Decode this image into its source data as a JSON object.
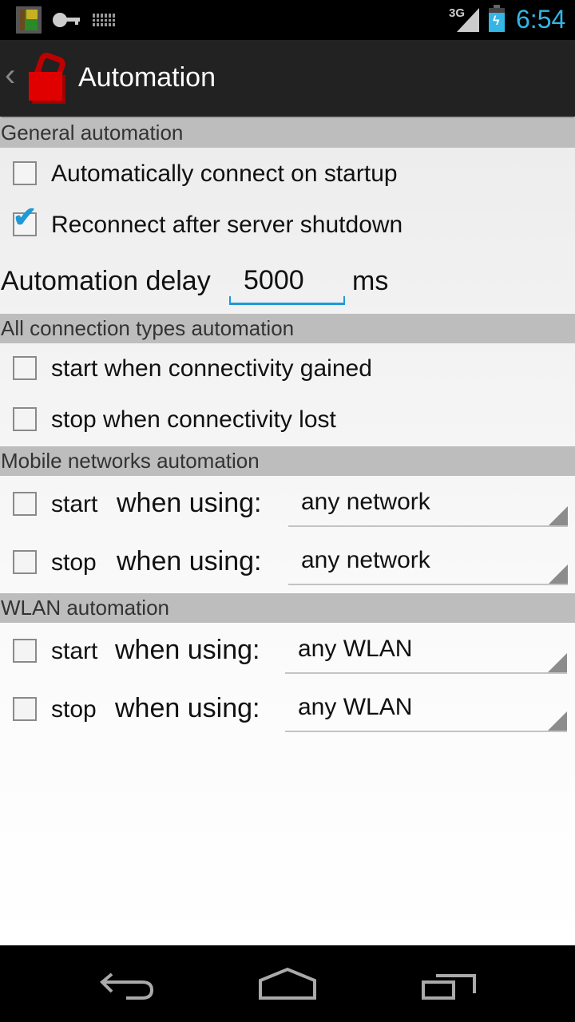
{
  "status_bar": {
    "icons_left": [
      "app-door-icon",
      "key-icon",
      "keyboard-icon"
    ],
    "network": "3G",
    "time": "6:54"
  },
  "action_bar": {
    "back_glyph": "‹",
    "title": "Automation"
  },
  "sections": {
    "general": {
      "title": "General automation",
      "items": [
        {
          "label": "Automatically connect on startup",
          "checked": false
        },
        {
          "label": "Reconnect after server shutdown",
          "checked": true
        }
      ],
      "delay": {
        "label": "Automation delay",
        "value": "5000",
        "unit": "ms"
      }
    },
    "all_connections": {
      "title": "All connection types automation",
      "items": [
        {
          "label": "start when connectivity gained",
          "checked": false
        },
        {
          "label": "stop when connectivity lost",
          "checked": false
        }
      ]
    },
    "mobile": {
      "title": "Mobile networks automation",
      "rows": [
        {
          "action": "start",
          "when": "when using:",
          "selected": "any network",
          "checked": false
        },
        {
          "action": "stop",
          "when": "when using:",
          "selected": "any network",
          "checked": false
        }
      ]
    },
    "wlan": {
      "title": "WLAN automation",
      "rows": [
        {
          "action": "start",
          "when": "when using:",
          "selected": "any WLAN",
          "checked": false
        },
        {
          "action": "stop",
          "when": "when using:",
          "selected": "any WLAN",
          "checked": false
        }
      ]
    }
  },
  "colors": {
    "accent": "#33b5e5",
    "checkmark": "#1e9ad6",
    "app_icon": "#e00000"
  }
}
